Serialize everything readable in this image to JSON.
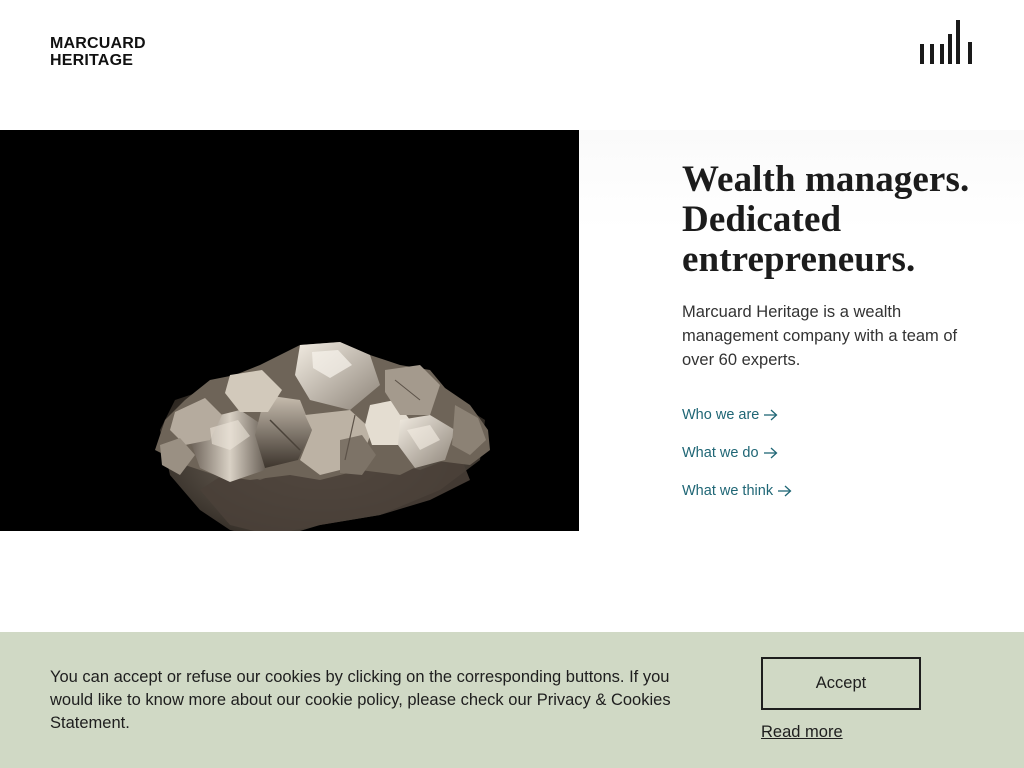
{
  "header": {
    "logo_line1": "MARCUARD",
    "logo_line2": "HERITAGE",
    "menu_icon": "menu-bars-icon"
  },
  "hero": {
    "image": "pyrite-mineral-photo",
    "headline_line1": "Wealth managers.",
    "headline_line2": "Dedicated",
    "headline_line3": "entrepreneurs.",
    "intro": "Marcuard Heritage is a wealth management company with a team of over 60 experts.",
    "links": [
      {
        "label": "Who we are",
        "icon": "arrow-right-icon"
      },
      {
        "label": "What we do",
        "icon": "arrow-right-icon"
      },
      {
        "label": "What we think",
        "icon": "arrow-right-icon"
      }
    ]
  },
  "cookie_banner": {
    "text": "You can accept or refuse our cookies by clicking on the corresponding buttons. If you would like to know more about our cookie policy, please check our Privacy & Cookies Statement.",
    "accept_label": "Accept",
    "read_more_label": "Read more"
  },
  "colors": {
    "link": "#1f6675",
    "banner_bg": "#d0d9c5",
    "text": "#1e1e1e",
    "image_bg": "#000000"
  }
}
